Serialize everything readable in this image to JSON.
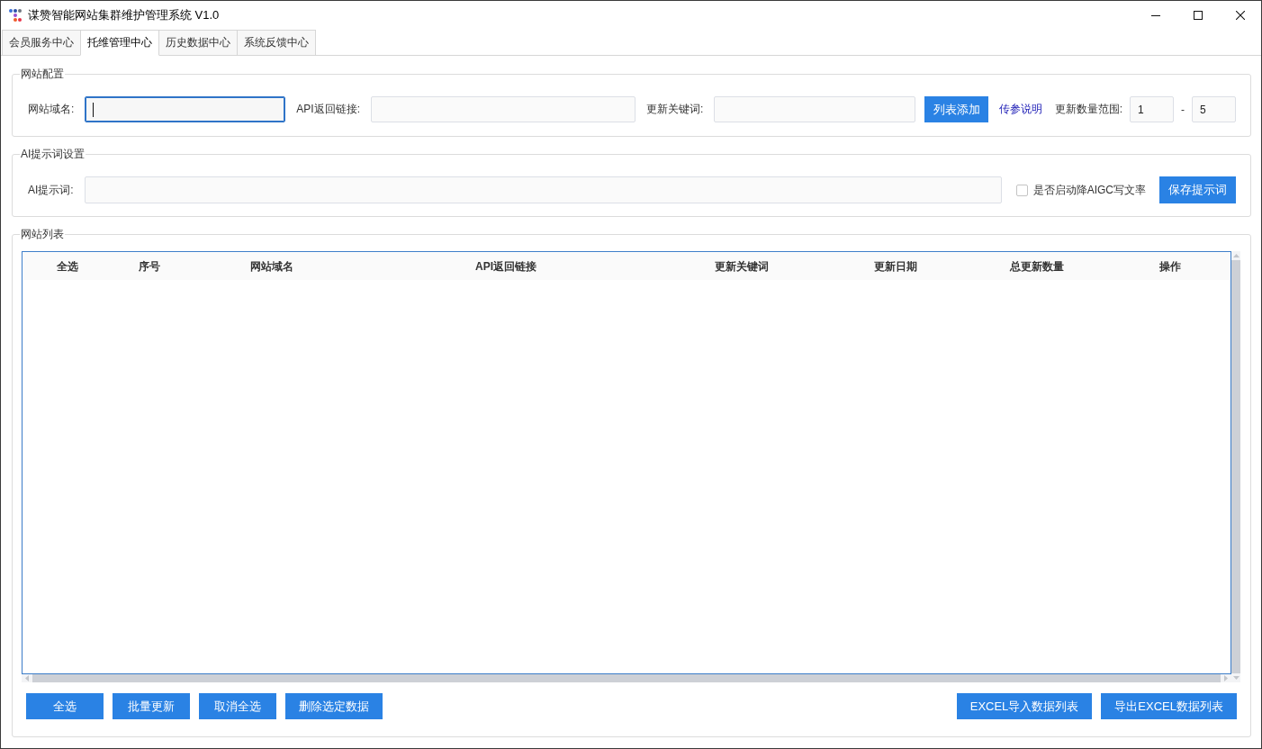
{
  "window": {
    "title": "谋赞智能网站集群维护管理系统 V1.0"
  },
  "tabs": [
    {
      "label": "会员服务中心",
      "selected": false
    },
    {
      "label": "托维管理中心",
      "selected": true
    },
    {
      "label": "历史数据中心",
      "selected": false
    },
    {
      "label": "系统反馈中心",
      "selected": false
    }
  ],
  "site_config": {
    "title": "网站配置",
    "fields": [
      {
        "label": "网站域名:",
        "focused": true
      },
      {
        "label": "API返回链接:",
        "focused": false
      },
      {
        "label": "更新关键词:",
        "focused": false
      }
    ],
    "add_button": "列表添加",
    "help_link": "传参说明",
    "range": {
      "label": "更新数量范围:",
      "from": "1",
      "separator": "-",
      "to": "5"
    }
  },
  "ai_prompt": {
    "title": "AI提示词设置",
    "label": "AI提示词:",
    "checkbox": {
      "label": "是否启动降AIGC写文率",
      "checked": false
    },
    "save_button": "保存提示词"
  },
  "site_list": {
    "title": "网站列表",
    "table": {
      "columns": [
        "全选",
        "序号",
        "网站域名",
        "API返回链接",
        "更新关键词",
        "更新日期",
        "总更新数量",
        "操作"
      ]
    },
    "left_buttons": [
      "全选",
      "批量更新",
      "取消全选",
      "删除选定数据"
    ],
    "right_buttons": [
      "EXCEL导入数据列表",
      "导出EXCEL数据列表"
    ]
  }
}
